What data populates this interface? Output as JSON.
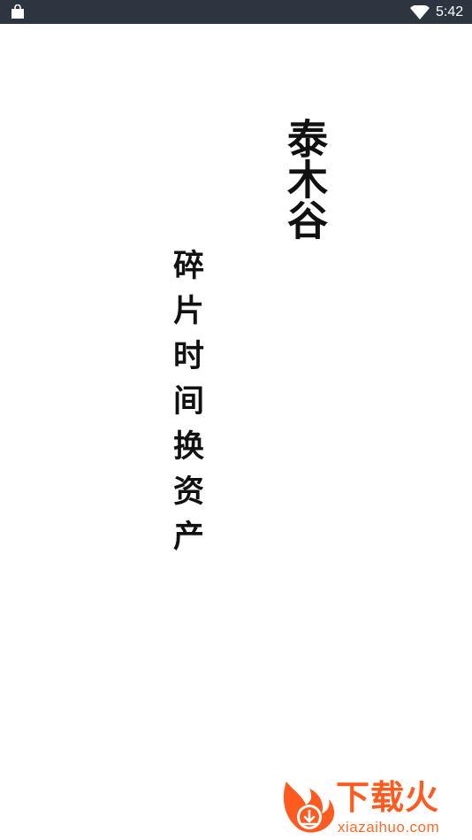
{
  "status_bar": {
    "time": "5:42",
    "icons": [
      "shopping-bag-icon",
      "wifi-icon"
    ],
    "background": "#2d3541"
  },
  "splash": {
    "brand": "泰木谷",
    "slogan": "碎片时间换资产"
  },
  "watermark": {
    "title": "下载火",
    "url": "xiazaihuo.com",
    "accent_color": "#ff5a1f"
  }
}
